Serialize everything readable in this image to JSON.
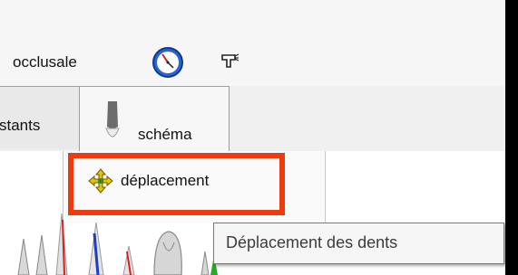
{
  "toolbar": {
    "view_label": "occlusale",
    "clock_icon": "clock-icon",
    "spray_icon": "spray-gun-icon"
  },
  "tabs": {
    "previous_label": "stants",
    "active_label": "schéma",
    "active_icon": "tooth-icon"
  },
  "subpanel": {
    "move_label": "déplacement",
    "move_icon": "move-arrows-icon"
  },
  "tooltip": {
    "text": "Déplacement des dents"
  },
  "colors": {
    "highlight": "#ee3a0f",
    "clock_blue": "#1e5cc8",
    "clock_red": "#d81e1e",
    "arrow_yellow": "#e8c400"
  }
}
